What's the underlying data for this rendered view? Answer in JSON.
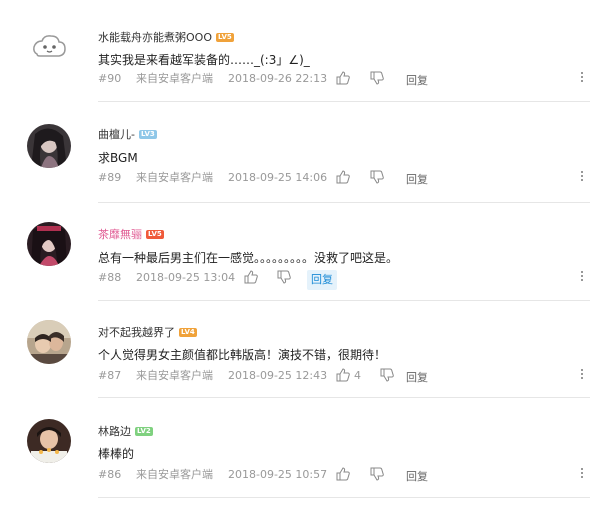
{
  "comments": [
    {
      "username": "水能载舟亦能煮粥OOO",
      "level": "LV5",
      "level_color": "#f0a23a",
      "text": "其实我是来看越军装备的……_(:3」∠)_",
      "floor": "#90",
      "source": "来自安卓客户端",
      "time": "2018-09-26 22:13",
      "like_count": "",
      "reply_label": "回复",
      "avatar_icon": "default-face-icon"
    },
    {
      "username": "曲檀儿-",
      "level": "LV3",
      "level_color": "#8fc7e8",
      "text": "求BGM",
      "floor": "#89",
      "source": "来自安卓客户端",
      "time": "2018-09-25 14:06",
      "like_count": "",
      "reply_label": "回复",
      "avatar_icon": "user-avatar-photo"
    },
    {
      "username": "茶靡無骊",
      "level": "LV5",
      "level_color": "#f05a3a",
      "name_color": "#e05b93",
      "text": "总有一种最后男主们在一感觉。。。。。。。。。没救了吧这是。",
      "floor": "#88",
      "source": "",
      "time": "2018-09-25 13:04",
      "like_count": "",
      "reply_label": "回复",
      "avatar_icon": "user-avatar-photo"
    },
    {
      "username": "对不起我越界了",
      "level": "LV4",
      "level_color": "#f0a23a",
      "text": "个人觉得男女主颜值都比韩版高！演技不错，很期待！",
      "floor": "#87",
      "source": "来自安卓客户端",
      "time": "2018-09-25 12:43",
      "like_count": "4",
      "reply_label": "回复",
      "avatar_icon": "user-avatar-photo"
    },
    {
      "username": "林路边",
      "level": "LV2",
      "level_color": "#7fd17f",
      "text": "棒棒的",
      "floor": "#86",
      "source": "来自安卓客户端",
      "time": "2018-09-25 10:57",
      "like_count": "",
      "reply_label": "回复",
      "avatar_icon": "user-avatar-photo"
    }
  ]
}
